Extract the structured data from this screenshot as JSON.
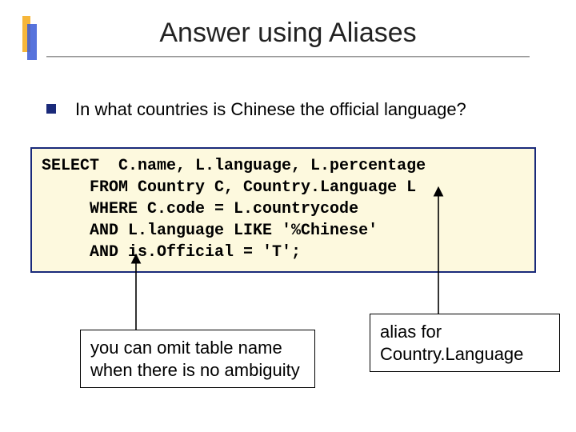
{
  "title": "Answer using Aliases",
  "bullet": "In what countries is Chinese the official language?",
  "code": {
    "line1_a": "SELECT  ",
    "line1_b": "C.name, L.language, L.percentage",
    "line2": "     FROM Country C, Country.Language L",
    "line3": "     WHERE C.code = L.countrycode",
    "line4": "     AND L.language LIKE '%Chinese'",
    "line5": "     AND is.Official = 'T';"
  },
  "notes": {
    "left": "you can omit table name when there is no ambiguity",
    "right": "alias for Country.Language"
  },
  "colors": {
    "accent_blue": "#1a2a7a",
    "accent_orange": "#f6b63a",
    "code_bg": "#fdf9de"
  }
}
